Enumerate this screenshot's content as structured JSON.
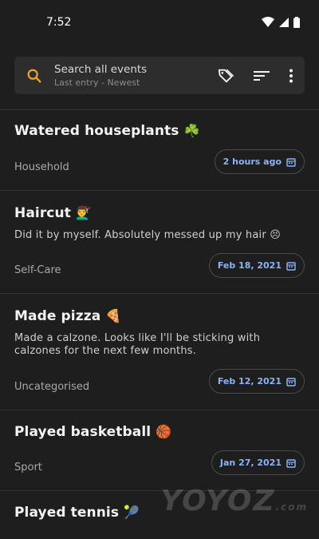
{
  "status_bar": {
    "time": "7:52"
  },
  "search": {
    "title": "Search all events",
    "subtitle": "Last entry - Newest",
    "icons": [
      "search-icon",
      "tag-icon",
      "sort-icon",
      "more-vert-icon"
    ]
  },
  "accent_color": "#8ab4f8",
  "events": [
    {
      "title": "Watered houseplants",
      "emoji": "☘️",
      "description": "",
      "category": "Household",
      "date": "2 hours ago"
    },
    {
      "title": "Haircut",
      "emoji": "💇‍♂️",
      "description": "Did it by myself. Absolutely messed up my hair 😣",
      "category": "Self-Care",
      "date": "Feb 18, 2021"
    },
    {
      "title": "Made pizza",
      "emoji": "🍕",
      "description": "Made a calzone. Looks like I'll be sticking with calzones for the next few months.",
      "category": "Uncategorised",
      "date": "Feb 12, 2021"
    },
    {
      "title": "Played basketball",
      "emoji": "🏀",
      "description": "",
      "category": "Sport",
      "date": "Jan 27, 2021"
    },
    {
      "title": "Played tennis",
      "emoji": "🎾",
      "description": "",
      "category": "",
      "date": ""
    }
  ],
  "watermark": {
    "main": "YOYOZ",
    "suffix": ".com"
  }
}
